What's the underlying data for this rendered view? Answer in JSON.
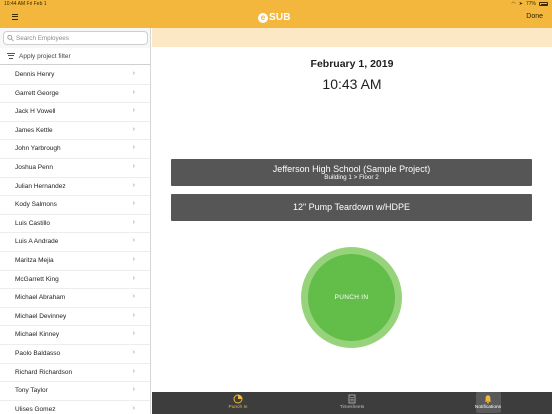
{
  "status_bar": {
    "time_date": "10:44 AM   Fri Feb 1",
    "battery": "77%"
  },
  "header": {
    "logo_mark": "e",
    "logo_text": "SUB",
    "done_label": "Done"
  },
  "sidebar": {
    "search": {
      "placeholder": "Search Employees",
      "value": ""
    },
    "filter_label": "Apply project filter",
    "employees": [
      "Dennis Henry",
      "Garrett George",
      "Jack H Vowell",
      "James Kettle",
      "John Yarbrough",
      "Joshua Penn",
      "Julian Hernandez",
      "Kody Salmons",
      "Luis Castillo",
      "Luis A Andrade",
      "Maritza Mejia",
      "McGarrett King",
      "Michael Abraham",
      "Michael Devinney",
      "Michael Kinney",
      "Paolo Baldasso",
      "Richard Richardson",
      "Tony Taylor",
      "Ulises Gomez"
    ]
  },
  "main": {
    "date": "February 1, 2019",
    "time": "10:43 AM",
    "project": {
      "name": "Jefferson High School (Sample Project)",
      "location": "Building 1  > Floor 2"
    },
    "task": "12\" Pump Teardown w/HDPE",
    "punch_label": "PUNCH IN"
  },
  "tabs": [
    {
      "label": "Punch In",
      "icon": "clock-icon",
      "active": true
    },
    {
      "label": "Timesheets",
      "icon": "timesheet-icon",
      "active": false
    },
    {
      "label": "Notifications",
      "icon": "bell-icon",
      "active": false
    }
  ],
  "colors": {
    "accent": "#f3b73d",
    "punch_green": "#62bd49",
    "banner": "#fce8c5",
    "dark_button": "#565656",
    "tabbar": "#3d3d3d"
  }
}
